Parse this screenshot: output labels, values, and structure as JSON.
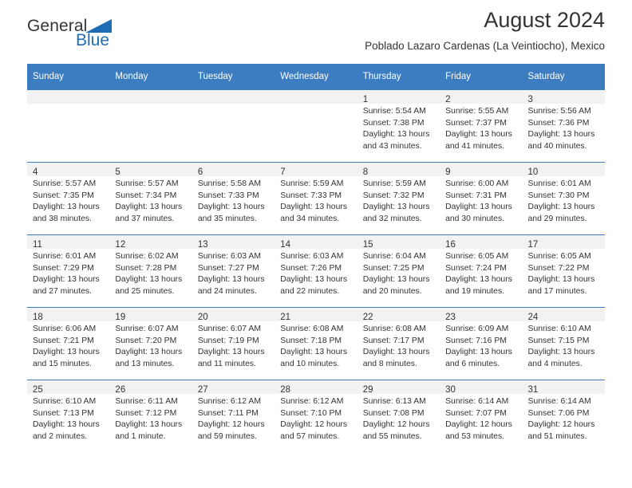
{
  "brand": {
    "name_part1": "General",
    "name_part2": "Blue",
    "accent_color": "#1f6cb4"
  },
  "header": {
    "title": "August 2024",
    "subtitle": "Poblado Lazaro Cardenas (La Veintiocho), Mexico"
  },
  "calendar": {
    "header_bg": "#3b7dc0",
    "daynum_bg": "#f2f2f2",
    "weekdays": [
      "Sunday",
      "Monday",
      "Tuesday",
      "Wednesday",
      "Thursday",
      "Friday",
      "Saturday"
    ],
    "weeks": [
      [
        {
          "day": "",
          "lines": []
        },
        {
          "day": "",
          "lines": []
        },
        {
          "day": "",
          "lines": []
        },
        {
          "day": "",
          "lines": []
        },
        {
          "day": "1",
          "lines": [
            "Sunrise: 5:54 AM",
            "Sunset: 7:38 PM",
            "Daylight: 13 hours",
            "and 43 minutes."
          ]
        },
        {
          "day": "2",
          "lines": [
            "Sunrise: 5:55 AM",
            "Sunset: 7:37 PM",
            "Daylight: 13 hours",
            "and 41 minutes."
          ]
        },
        {
          "day": "3",
          "lines": [
            "Sunrise: 5:56 AM",
            "Sunset: 7:36 PM",
            "Daylight: 13 hours",
            "and 40 minutes."
          ]
        }
      ],
      [
        {
          "day": "4",
          "lines": [
            "Sunrise: 5:57 AM",
            "Sunset: 7:35 PM",
            "Daylight: 13 hours",
            "and 38 minutes."
          ]
        },
        {
          "day": "5",
          "lines": [
            "Sunrise: 5:57 AM",
            "Sunset: 7:34 PM",
            "Daylight: 13 hours",
            "and 37 minutes."
          ]
        },
        {
          "day": "6",
          "lines": [
            "Sunrise: 5:58 AM",
            "Sunset: 7:33 PM",
            "Daylight: 13 hours",
            "and 35 minutes."
          ]
        },
        {
          "day": "7",
          "lines": [
            "Sunrise: 5:59 AM",
            "Sunset: 7:33 PM",
            "Daylight: 13 hours",
            "and 34 minutes."
          ]
        },
        {
          "day": "8",
          "lines": [
            "Sunrise: 5:59 AM",
            "Sunset: 7:32 PM",
            "Daylight: 13 hours",
            "and 32 minutes."
          ]
        },
        {
          "day": "9",
          "lines": [
            "Sunrise: 6:00 AM",
            "Sunset: 7:31 PM",
            "Daylight: 13 hours",
            "and 30 minutes."
          ]
        },
        {
          "day": "10",
          "lines": [
            "Sunrise: 6:01 AM",
            "Sunset: 7:30 PM",
            "Daylight: 13 hours",
            "and 29 minutes."
          ]
        }
      ],
      [
        {
          "day": "11",
          "lines": [
            "Sunrise: 6:01 AM",
            "Sunset: 7:29 PM",
            "Daylight: 13 hours",
            "and 27 minutes."
          ]
        },
        {
          "day": "12",
          "lines": [
            "Sunrise: 6:02 AM",
            "Sunset: 7:28 PM",
            "Daylight: 13 hours",
            "and 25 minutes."
          ]
        },
        {
          "day": "13",
          "lines": [
            "Sunrise: 6:03 AM",
            "Sunset: 7:27 PM",
            "Daylight: 13 hours",
            "and 24 minutes."
          ]
        },
        {
          "day": "14",
          "lines": [
            "Sunrise: 6:03 AM",
            "Sunset: 7:26 PM",
            "Daylight: 13 hours",
            "and 22 minutes."
          ]
        },
        {
          "day": "15",
          "lines": [
            "Sunrise: 6:04 AM",
            "Sunset: 7:25 PM",
            "Daylight: 13 hours",
            "and 20 minutes."
          ]
        },
        {
          "day": "16",
          "lines": [
            "Sunrise: 6:05 AM",
            "Sunset: 7:24 PM",
            "Daylight: 13 hours",
            "and 19 minutes."
          ]
        },
        {
          "day": "17",
          "lines": [
            "Sunrise: 6:05 AM",
            "Sunset: 7:22 PM",
            "Daylight: 13 hours",
            "and 17 minutes."
          ]
        }
      ],
      [
        {
          "day": "18",
          "lines": [
            "Sunrise: 6:06 AM",
            "Sunset: 7:21 PM",
            "Daylight: 13 hours",
            "and 15 minutes."
          ]
        },
        {
          "day": "19",
          "lines": [
            "Sunrise: 6:07 AM",
            "Sunset: 7:20 PM",
            "Daylight: 13 hours",
            "and 13 minutes."
          ]
        },
        {
          "day": "20",
          "lines": [
            "Sunrise: 6:07 AM",
            "Sunset: 7:19 PM",
            "Daylight: 13 hours",
            "and 11 minutes."
          ]
        },
        {
          "day": "21",
          "lines": [
            "Sunrise: 6:08 AM",
            "Sunset: 7:18 PM",
            "Daylight: 13 hours",
            "and 10 minutes."
          ]
        },
        {
          "day": "22",
          "lines": [
            "Sunrise: 6:08 AM",
            "Sunset: 7:17 PM",
            "Daylight: 13 hours",
            "and 8 minutes."
          ]
        },
        {
          "day": "23",
          "lines": [
            "Sunrise: 6:09 AM",
            "Sunset: 7:16 PM",
            "Daylight: 13 hours",
            "and 6 minutes."
          ]
        },
        {
          "day": "24",
          "lines": [
            "Sunrise: 6:10 AM",
            "Sunset: 7:15 PM",
            "Daylight: 13 hours",
            "and 4 minutes."
          ]
        }
      ],
      [
        {
          "day": "25",
          "lines": [
            "Sunrise: 6:10 AM",
            "Sunset: 7:13 PM",
            "Daylight: 13 hours",
            "and 2 minutes."
          ]
        },
        {
          "day": "26",
          "lines": [
            "Sunrise: 6:11 AM",
            "Sunset: 7:12 PM",
            "Daylight: 13 hours",
            "and 1 minute."
          ]
        },
        {
          "day": "27",
          "lines": [
            "Sunrise: 6:12 AM",
            "Sunset: 7:11 PM",
            "Daylight: 12 hours",
            "and 59 minutes."
          ]
        },
        {
          "day": "28",
          "lines": [
            "Sunrise: 6:12 AM",
            "Sunset: 7:10 PM",
            "Daylight: 12 hours",
            "and 57 minutes."
          ]
        },
        {
          "day": "29",
          "lines": [
            "Sunrise: 6:13 AM",
            "Sunset: 7:08 PM",
            "Daylight: 12 hours",
            "and 55 minutes."
          ]
        },
        {
          "day": "30",
          "lines": [
            "Sunrise: 6:14 AM",
            "Sunset: 7:07 PM",
            "Daylight: 12 hours",
            "and 53 minutes."
          ]
        },
        {
          "day": "31",
          "lines": [
            "Sunrise: 6:14 AM",
            "Sunset: 7:06 PM",
            "Daylight: 12 hours",
            "and 51 minutes."
          ]
        }
      ]
    ]
  }
}
